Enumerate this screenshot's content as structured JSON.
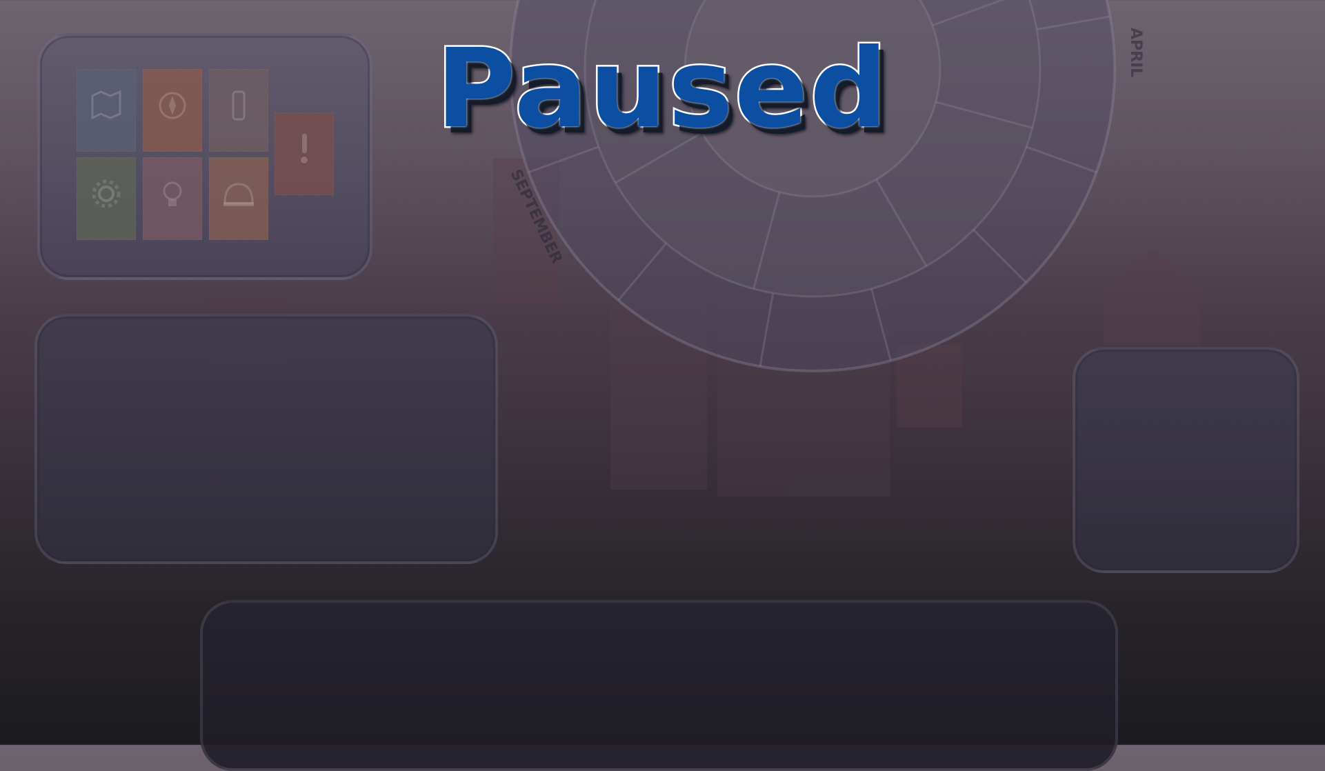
{
  "overlay": {
    "title": "Paused"
  },
  "board": {
    "months": [
      "APRIL",
      "SEPTEMBER"
    ],
    "colors": {
      "title_fill": "#0b4ea2",
      "title_stroke": "#ffffff",
      "title_shadow": "#141c2b"
    }
  },
  "inventory": {
    "cards": [
      {
        "icon": "map-icon",
        "color": "#5a6075"
      },
      {
        "icon": "compass-icon",
        "color": "#8a5a4c"
      },
      {
        "icon": "bottle-icon",
        "color": "#6f5e62"
      },
      {
        "icon": "warning-icon",
        "color": "#7a4e4c"
      },
      {
        "icon": "gear-icon",
        "color": "#5f6458"
      },
      {
        "icon": "lightbulb-icon",
        "color": "#7a5a62"
      },
      {
        "icon": "helmet-icon",
        "color": "#876052"
      }
    ]
  }
}
